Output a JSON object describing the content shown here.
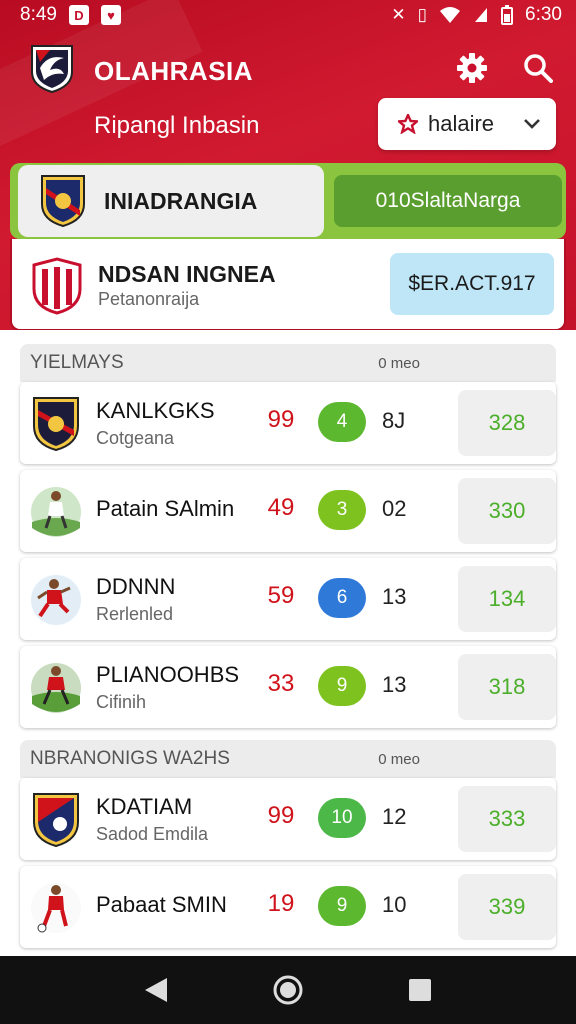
{
  "status_bar": {
    "time": "8:49",
    "right_time": "6:30",
    "icons": [
      "notification-icon",
      "shield-icon",
      "bluetooth-icon",
      "vibrate-icon",
      "wifi-icon",
      "signal-icon",
      "battery-icon"
    ]
  },
  "app": {
    "title": "OLAHRASIA",
    "subtitle": "Ripangl Inbasin",
    "dropdown_label": "halaire"
  },
  "featured": {
    "name": "INIADRANGIA",
    "button": "010SlaltaNarga"
  },
  "opponent": {
    "name": "NDSAN INGNEA",
    "sub": "Petanonraija",
    "pill": "$ER.ACT.917"
  },
  "sections": [
    {
      "label": "YIELMAYS",
      "meta": "0 meo",
      "rows": [
        {
          "name": "KANLKGKS",
          "sub": "Cotgeana",
          "score": "99",
          "badge": "4",
          "badge_color": "#5cb82e",
          "stat": "8J",
          "pts": "328",
          "avatar": "crest-icon"
        },
        {
          "name": "Patain SAlmin",
          "sub": "",
          "score": "49",
          "badge": "3",
          "badge_color": "#7dc21f",
          "stat": "02",
          "pts": "330",
          "avatar": "player-photo-icon"
        },
        {
          "name": "DDNNN",
          "sub": "Rerlenled",
          "score": "59",
          "badge": "6",
          "badge_color": "#2f7ad9",
          "stat": "13",
          "pts": "134",
          "avatar": "player-photo-icon"
        },
        {
          "name": "PLIANOOHBS",
          "sub": "Cifinih",
          "score": "33",
          "badge": "9",
          "badge_color": "#7dc21f",
          "stat": "13",
          "pts": "318",
          "avatar": "player-photo-icon"
        }
      ]
    },
    {
      "label": "NBRANONIGS WA2HS",
      "meta": "0 meo",
      "rows": [
        {
          "name": "KDATIAM",
          "sub": "Sadod Emdila",
          "score": "99",
          "badge": "10",
          "badge_color": "#4cb848",
          "stat": "12",
          "pts": "333",
          "avatar": "crest-icon"
        },
        {
          "name": "Pabaat SMIN",
          "sub": "",
          "score": "19",
          "badge": "9",
          "badge_color": "#5cb82e",
          "stat": "10",
          "pts": "339",
          "avatar": "player-photo-icon"
        }
      ]
    }
  ],
  "nav": {
    "back": "back-icon",
    "home": "home-icon",
    "recents": "recents-icon"
  }
}
